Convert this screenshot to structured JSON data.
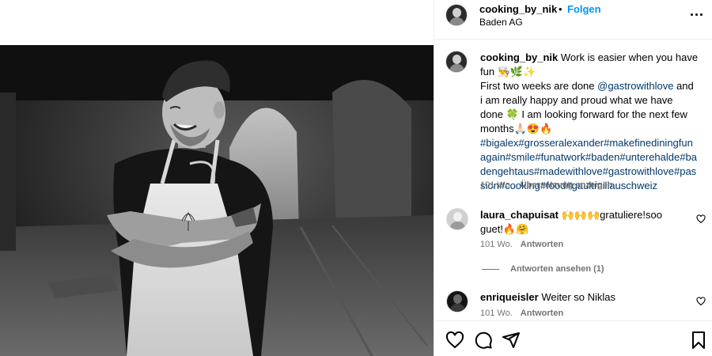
{
  "header": {
    "username": "cooking_by_nik",
    "separator": "•",
    "follow_label": "Folgen",
    "location": "Baden AG"
  },
  "caption": {
    "username": "cooking_by_nik",
    "line1": "Work is easier when you have fun 👨‍🍳🌿✨",
    "line2_pre": "First two weeks are done ",
    "mention": "@gastrowithlove",
    "line2_post": " and i am really happy and proud what we have done 🍀 I am looking forward for the next few months🙏🏻😍🔥",
    "hashtags": "#bigalex#grosseralexander#makefinediningfunagain#smile#funatwork#baden#unterehalde#badengehtaus#madewithlove#gastrowithlove#passion#cooking#food#gaultmillauschweiz",
    "age": "101 Wo.",
    "translate_label": "Übersetzung anzeigen"
  },
  "comments": [
    {
      "username": "laura_chapuisat",
      "text": "🙌🙌🙌gratuliere!soo guet!🔥🤗",
      "age": "101 Wo.",
      "reply_label": "Antworten",
      "avatar": "grey"
    },
    {
      "username": "enriqueisler",
      "text": "Weiter so Niklas",
      "age": "101 Wo.",
      "reply_label": "Antworten",
      "avatar": "dark"
    }
  ],
  "view_replies_label": "Antworten ansehen (1)",
  "icons": {
    "more": "more-horizontal-icon",
    "like": "heart-icon",
    "comment": "comment-icon",
    "share": "share-icon",
    "save": "bookmark-icon"
  },
  "photo": {
    "description_icon": "chef-photo",
    "apron_logo": "flower-icon"
  }
}
